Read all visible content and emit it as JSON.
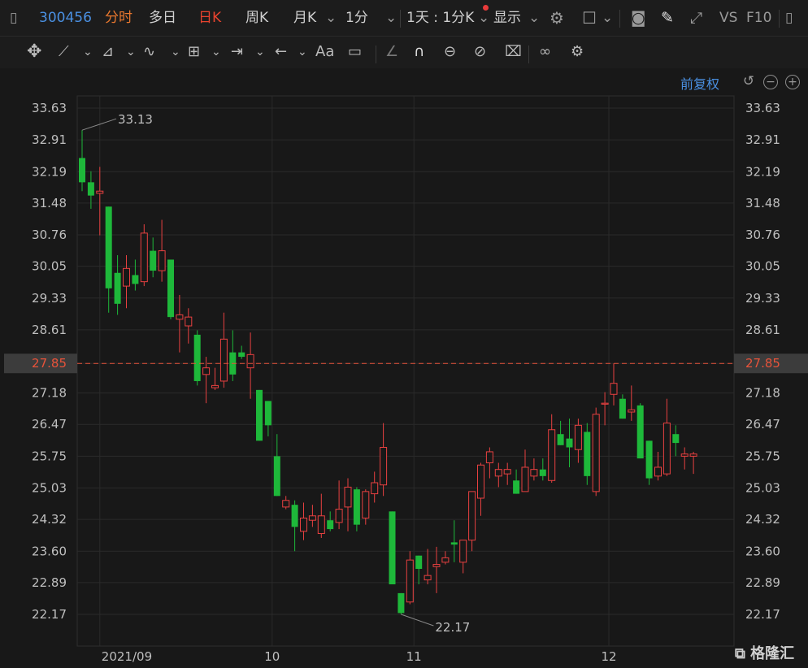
{
  "header": {
    "stock_code": "300456",
    "tabs": [
      "分时",
      "多日",
      "日K",
      "周K",
      "月K",
      "1分"
    ],
    "active_tab": "日K",
    "period_selector": "1天 : 1分K",
    "display_label": "显示",
    "vs_label": "VS",
    "f10_label": "F10"
  },
  "toolbar2": {
    "text_tool": "Aa"
  },
  "chart_controls": {
    "adjust_label": "前复权"
  },
  "colors": {
    "up": "#e84040",
    "down": "#1eb83a",
    "crosshair": "#e8533a",
    "axis_text": "#bfbfbf",
    "grid": "#2a2a2a"
  },
  "chart_data": {
    "type": "candlestick",
    "y_ticks": [
      "33.63",
      "32.91",
      "32.19",
      "31.48",
      "30.76",
      "30.05",
      "29.33",
      "28.61",
      "27.85",
      "27.18",
      "26.47",
      "25.75",
      "25.03",
      "24.32",
      "23.60",
      "22.89",
      "22.17"
    ],
    "ylim": [
      21.7,
      33.9
    ],
    "x_labels": [
      {
        "label": "2021/09",
        "index": 2
      },
      {
        "label": "10",
        "index": 22
      },
      {
        "label": "11",
        "index": 38
      },
      {
        "label": "12",
        "index": 60
      }
    ],
    "crosshair_value": "27.85",
    "high_annotation": {
      "text": "33.13",
      "index": 0,
      "value": 33.13
    },
    "low_annotation": {
      "text": "22.17",
      "index": 36,
      "value": 22.17
    },
    "candles": [
      {
        "o": 32.5,
        "h": 33.13,
        "l": 31.75,
        "c": 31.95
      },
      {
        "o": 31.95,
        "h": 32.2,
        "l": 31.35,
        "c": 31.65
      },
      {
        "o": 31.7,
        "h": 32.3,
        "l": 30.75,
        "c": 31.75
      },
      {
        "o": 31.4,
        "h": 31.4,
        "l": 29.0,
        "c": 29.55
      },
      {
        "o": 29.9,
        "h": 30.3,
        "l": 28.95,
        "c": 29.2
      },
      {
        "o": 29.6,
        "h": 30.3,
        "l": 29.1,
        "c": 30.0
      },
      {
        "o": 29.85,
        "h": 30.2,
        "l": 29.5,
        "c": 29.65
      },
      {
        "o": 29.7,
        "h": 31.0,
        "l": 29.6,
        "c": 30.8
      },
      {
        "o": 30.4,
        "h": 30.7,
        "l": 29.8,
        "c": 29.95
      },
      {
        "o": 29.95,
        "h": 31.1,
        "l": 29.7,
        "c": 30.4
      },
      {
        "o": 30.2,
        "h": 30.2,
        "l": 28.85,
        "c": 28.9
      },
      {
        "o": 28.85,
        "h": 29.4,
        "l": 28.1,
        "c": 28.95
      },
      {
        "o": 28.7,
        "h": 29.1,
        "l": 28.3,
        "c": 28.9
      },
      {
        "o": 28.5,
        "h": 28.6,
        "l": 27.35,
        "c": 27.45
      },
      {
        "o": 27.6,
        "h": 28.0,
        "l": 26.95,
        "c": 27.75
      },
      {
        "o": 27.3,
        "h": 27.75,
        "l": 27.25,
        "c": 27.35
      },
      {
        "o": 27.45,
        "h": 29.0,
        "l": 27.3,
        "c": 28.4
      },
      {
        "o": 28.1,
        "h": 28.6,
        "l": 27.45,
        "c": 27.6
      },
      {
        "o": 28.1,
        "h": 28.25,
        "l": 27.95,
        "c": 28.0
      },
      {
        "o": 27.75,
        "h": 28.55,
        "l": 27.05,
        "c": 28.05
      },
      {
        "o": 27.25,
        "h": 27.25,
        "l": 26.15,
        "c": 26.1
      },
      {
        "o": 27.0,
        "h": 27.0,
        "l": 26.2,
        "c": 26.45
      },
      {
        "o": 25.75,
        "h": 26.25,
        "l": 24.95,
        "c": 24.85
      },
      {
        "o": 24.6,
        "h": 24.85,
        "l": 24.55,
        "c": 24.75
      },
      {
        "o": 24.65,
        "h": 24.75,
        "l": 23.6,
        "c": 24.15
      },
      {
        "o": 24.05,
        "h": 24.7,
        "l": 23.85,
        "c": 24.35
      },
      {
        "o": 24.3,
        "h": 24.65,
        "l": 24.15,
        "c": 24.4
      },
      {
        "o": 24.0,
        "h": 24.9,
        "l": 23.9,
        "c": 24.4
      },
      {
        "o": 24.3,
        "h": 24.5,
        "l": 24.05,
        "c": 24.1
      },
      {
        "o": 24.25,
        "h": 25.2,
        "l": 24.1,
        "c": 24.55
      },
      {
        "o": 24.6,
        "h": 25.25,
        "l": 24.05,
        "c": 25.05
      },
      {
        "o": 25.0,
        "h": 25.05,
        "l": 24.05,
        "c": 24.2
      },
      {
        "o": 24.35,
        "h": 25.0,
        "l": 24.2,
        "c": 24.95
      },
      {
        "o": 24.9,
        "h": 25.4,
        "l": 24.7,
        "c": 25.15
      },
      {
        "o": 25.1,
        "h": 26.5,
        "l": 24.85,
        "c": 25.95
      },
      {
        "o": 24.5,
        "h": 24.5,
        "l": 22.85,
        "c": 22.85
      },
      {
        "o": 22.65,
        "h": 22.6,
        "l": 22.17,
        "c": 22.2
      },
      {
        "o": 22.45,
        "h": 23.6,
        "l": 22.4,
        "c": 23.4
      },
      {
        "o": 23.5,
        "h": 23.4,
        "l": 22.85,
        "c": 23.2
      },
      {
        "o": 22.95,
        "h": 23.65,
        "l": 22.85,
        "c": 23.05
      },
      {
        "o": 23.25,
        "h": 23.7,
        "l": 22.65,
        "c": 23.3
      },
      {
        "o": 23.35,
        "h": 23.6,
        "l": 23.3,
        "c": 23.45
      },
      {
        "o": 23.8,
        "h": 24.3,
        "l": 23.35,
        "c": 23.75
      },
      {
        "o": 23.35,
        "h": 23.75,
        "l": 23.1,
        "c": 23.85
      },
      {
        "o": 23.85,
        "h": 24.5,
        "l": 23.6,
        "c": 24.95
      },
      {
        "o": 24.8,
        "h": 25.6,
        "l": 24.4,
        "c": 25.55
      },
      {
        "o": 25.6,
        "h": 25.95,
        "l": 25.25,
        "c": 25.85
      },
      {
        "o": 25.3,
        "h": 25.6,
        "l": 25.05,
        "c": 25.45
      },
      {
        "o": 25.35,
        "h": 25.6,
        "l": 25.1,
        "c": 25.45
      },
      {
        "o": 25.2,
        "h": 25.45,
        "l": 24.9,
        "c": 24.9
      },
      {
        "o": 24.95,
        "h": 25.9,
        "l": 24.95,
        "c": 25.5
      },
      {
        "o": 25.3,
        "h": 25.7,
        "l": 25.2,
        "c": 25.45
      },
      {
        "o": 25.45,
        "h": 25.7,
        "l": 25.2,
        "c": 25.3
      },
      {
        "o": 25.2,
        "h": 26.7,
        "l": 25.15,
        "c": 26.35
      },
      {
        "o": 26.25,
        "h": 26.55,
        "l": 26.0,
        "c": 26.0
      },
      {
        "o": 26.15,
        "h": 26.6,
        "l": 25.5,
        "c": 25.95
      },
      {
        "o": 25.9,
        "h": 26.6,
        "l": 25.6,
        "c": 26.45
      },
      {
        "o": 26.3,
        "h": 26.5,
        "l": 25.1,
        "c": 25.3
      },
      {
        "o": 24.95,
        "h": 26.85,
        "l": 24.85,
        "c": 26.7
      },
      {
        "o": 26.95,
        "h": 27.2,
        "l": 26.45,
        "c": 26.95
      },
      {
        "o": 27.15,
        "h": 27.85,
        "l": 26.9,
        "c": 27.4
      },
      {
        "o": 27.05,
        "h": 27.15,
        "l": 26.6,
        "c": 26.6
      },
      {
        "o": 26.75,
        "h": 27.35,
        "l": 26.55,
        "c": 26.8
      },
      {
        "o": 26.9,
        "h": 26.95,
        "l": 25.7,
        "c": 25.7
      },
      {
        "o": 26.1,
        "h": 26.1,
        "l": 25.1,
        "c": 25.25
      },
      {
        "o": 25.3,
        "h": 25.85,
        "l": 25.2,
        "c": 25.5
      },
      {
        "o": 25.35,
        "h": 27.05,
        "l": 25.3,
        "c": 26.5
      },
      {
        "o": 26.25,
        "h": 26.45,
        "l": 25.75,
        "c": 26.05
      },
      {
        "o": 25.75,
        "h": 25.95,
        "l": 25.45,
        "c": 25.8
      },
      {
        "o": 25.75,
        "h": 25.85,
        "l": 25.35,
        "c": 25.8
      }
    ]
  }
}
